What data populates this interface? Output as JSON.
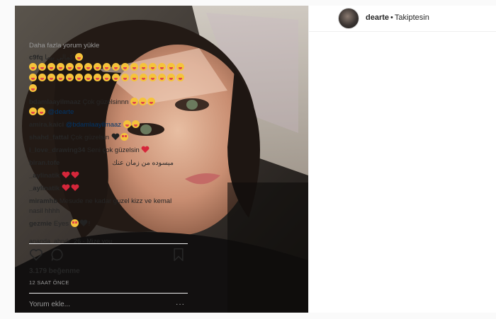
{
  "post": {
    "username": "dearte",
    "follow_label": "Takiptesin",
    "load_more": "Daha fazla yorum yükle",
    "comments": [
      {
        "user": "c9fq",
        "text": "كمالي بيما",
        "emojis": []
      },
      {
        "user": "bdamlaayilmaaz",
        "text": "Çok güzelsinnn",
        "mention": "@dearte"
      },
      {
        "user": "amira.kaici",
        "text": "",
        "mention": "@bdamlaayilmaaz"
      },
      {
        "user": "shahd_fattal",
        "text": "Çok güzelsin"
      },
      {
        "user": "i_love_drawing34",
        "text": "Seni çok güzelsin"
      },
      {
        "user": "biran.tofe",
        "text": "ميسوده من زمان عنك"
      },
      {
        "user": "_aylinatik",
        "text": ""
      },
      {
        "user": "_aylinatik",
        "text": ""
      },
      {
        "user": "miramhb",
        "text": "Mesude ne kadar guzel kizz ve kemal nasil hhhh"
      },
      {
        "user": "gezmie",
        "text": "Eyes",
        "suffix": "!"
      }
    ],
    "cut_off_text": "ananda_ahndr_26 · Mize you",
    "likes": "3.179 beğenme",
    "time": "12 SAAT ÖNCE",
    "add_comment_placeholder": "Yorum ekle...",
    "more_options": "..."
  },
  "icons": {
    "like": "heart-outline-icon",
    "comment": "speech-bubble-icon",
    "save": "bookmark-icon",
    "emoji": "yum-face-icon"
  },
  "colors": {
    "link_blue": "#003569",
    "heart_red": "#d6263a",
    "muted": "#999999"
  }
}
